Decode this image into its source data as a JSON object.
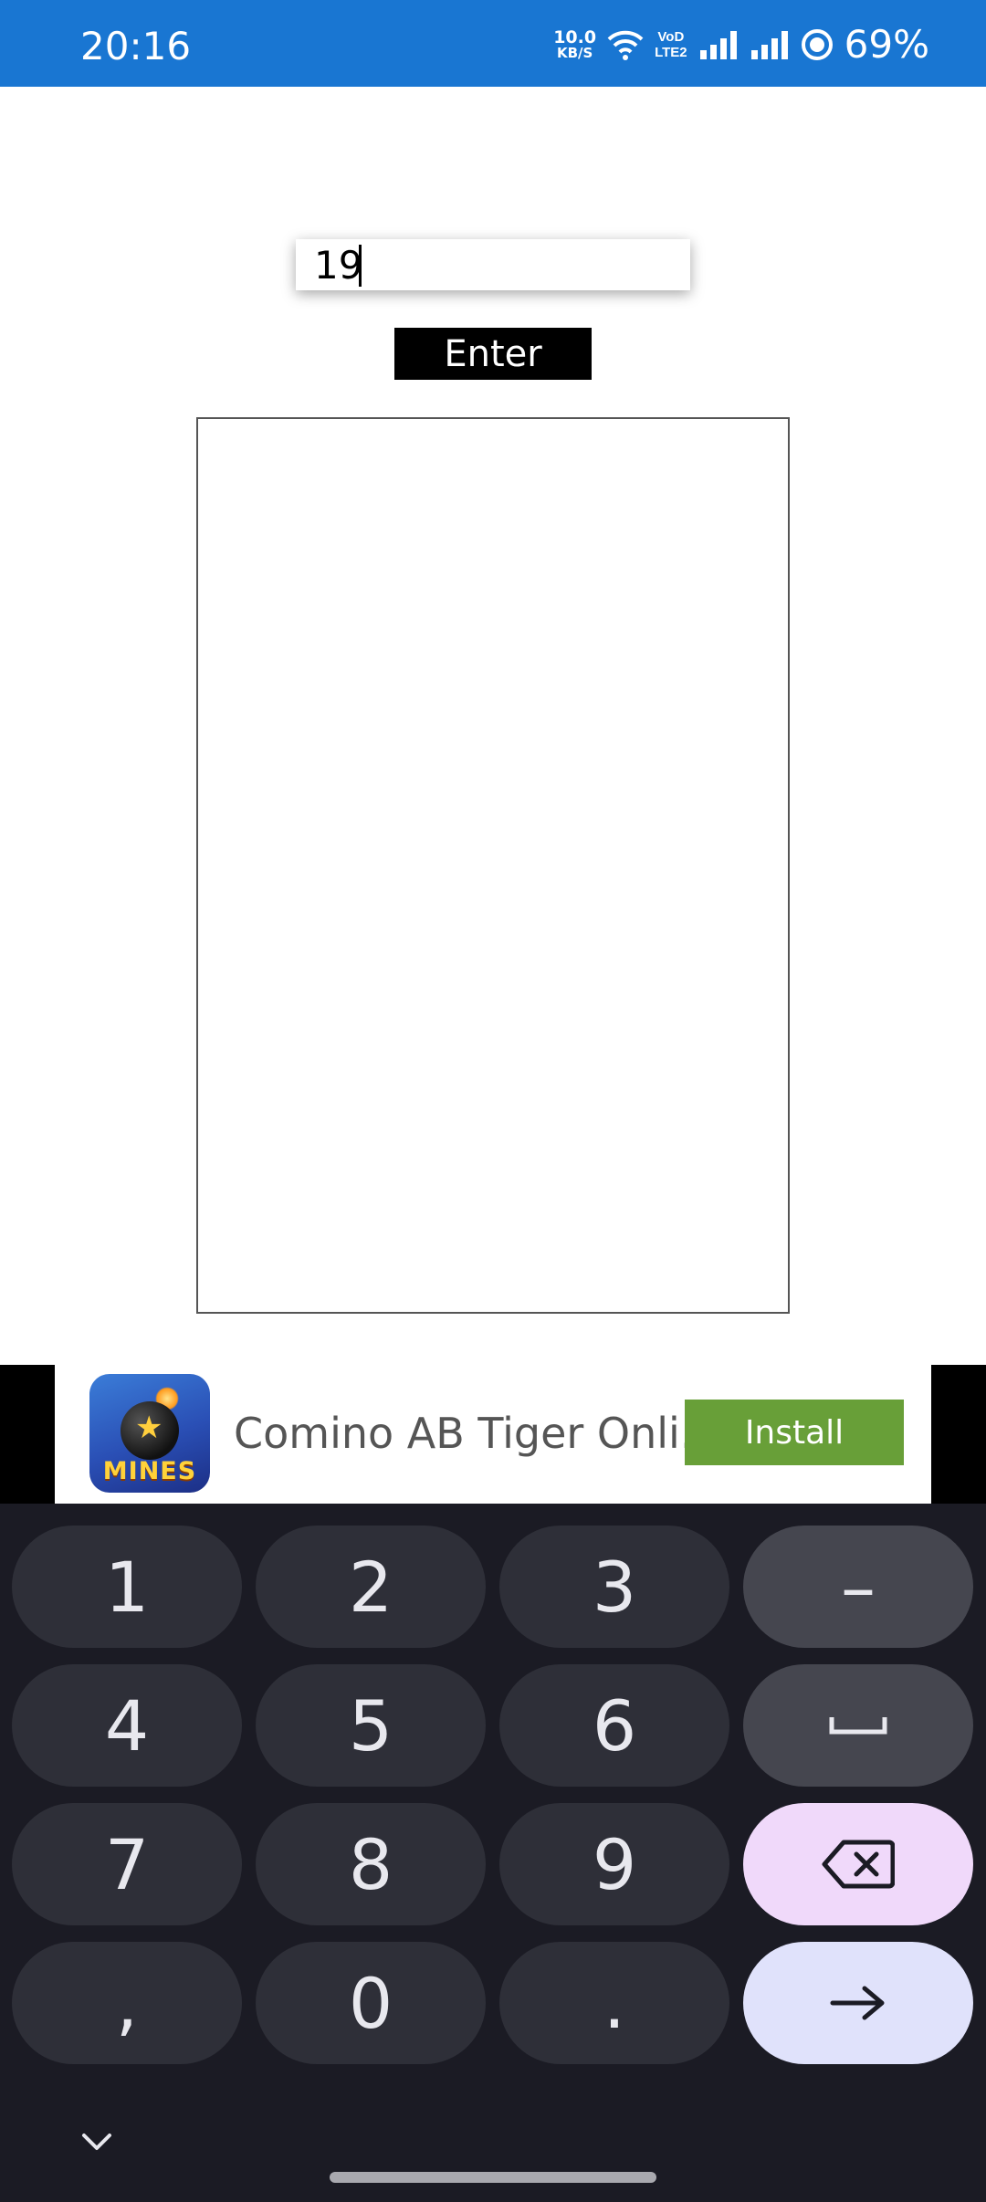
{
  "status_bar": {
    "time": "20:16",
    "net_speed_value": "10.0",
    "net_speed_unit": "KB/S",
    "volte_top": "VoD",
    "volte_bottom": "LTE2",
    "battery": "69%",
    "icons": [
      "wifi-icon",
      "volte-icon",
      "signal-icon",
      "signal-icon",
      "battery-saver-icon"
    ]
  },
  "app": {
    "input_value": "19",
    "enter_label": "Enter"
  },
  "ad": {
    "icon_label": "MINES",
    "title": "Comino AB Tiger Onli...",
    "install_label": "Install",
    "install_color": "#689f38"
  },
  "keyboard": {
    "keys": {
      "k1": "1",
      "k2": "2",
      "k3": "3",
      "minus": "–",
      "k4": "4",
      "k5": "5",
      "k6": "6",
      "k7": "7",
      "k8": "8",
      "k9": "9",
      "comma": ",",
      "k0": "0",
      "period": "."
    },
    "icons": [
      "space-icon",
      "backspace-icon",
      "go-arrow-icon",
      "chevron-down-icon"
    ],
    "colors": {
      "background": "#1b1b24",
      "key": "#2e2f38",
      "func_key": "#45464f",
      "backspace_key": "#f0d9fa",
      "go_key": "#e0e2fb"
    }
  }
}
